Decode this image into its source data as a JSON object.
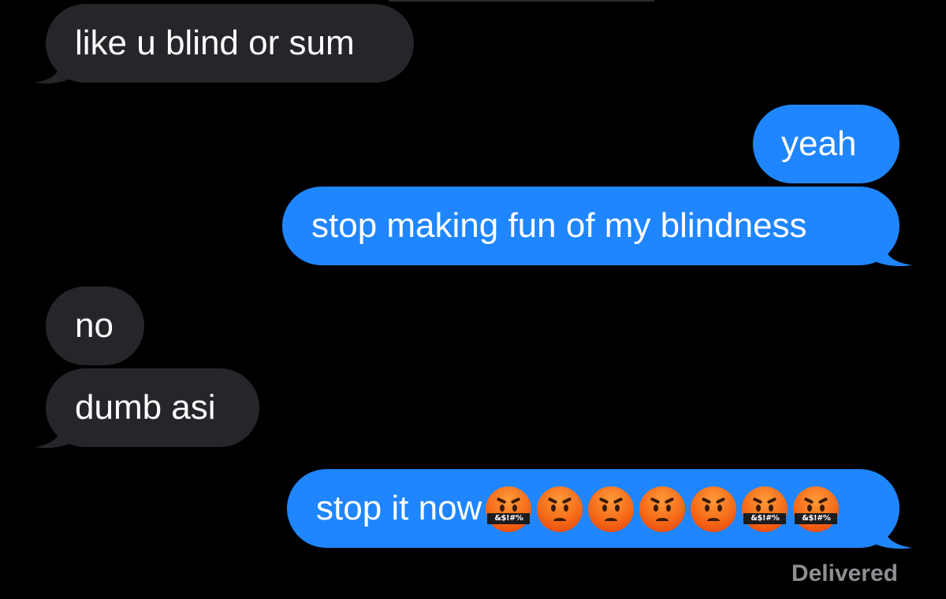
{
  "messages": [
    {
      "id": "b1",
      "direction": "incoming",
      "text": "like u blind or sum",
      "tail": true
    },
    {
      "id": "b2",
      "direction": "outgoing",
      "text": "yeah",
      "tail": false
    },
    {
      "id": "b3",
      "direction": "outgoing",
      "text": "stop making fun of my blindness",
      "tail": true
    },
    {
      "id": "b4",
      "direction": "incoming",
      "text": "no",
      "tail": false
    },
    {
      "id": "b5",
      "direction": "incoming",
      "text": "dumb asi",
      "tail": true
    },
    {
      "id": "b6",
      "direction": "outgoing",
      "text": "stop it now",
      "tail": true,
      "emojis": [
        {
          "icon": "face-with-symbols-on-mouth-icon",
          "symbols": "&$!#%"
        },
        {
          "icon": "pouting-face-icon"
        },
        {
          "icon": "pouting-face-icon"
        },
        {
          "icon": "pouting-face-icon"
        },
        {
          "icon": "pouting-face-icon"
        },
        {
          "icon": "face-with-symbols-on-mouth-icon",
          "symbols": "&$!#%"
        },
        {
          "icon": "face-with-symbols-on-mouth-icon",
          "symbols": "&$!#%"
        }
      ]
    }
  ],
  "status": "Delivered",
  "colors": {
    "background": "#000000",
    "incoming_bubble": "#26252a",
    "outgoing_bubble": "#1f86ff",
    "status_text": "#8e8e93"
  }
}
